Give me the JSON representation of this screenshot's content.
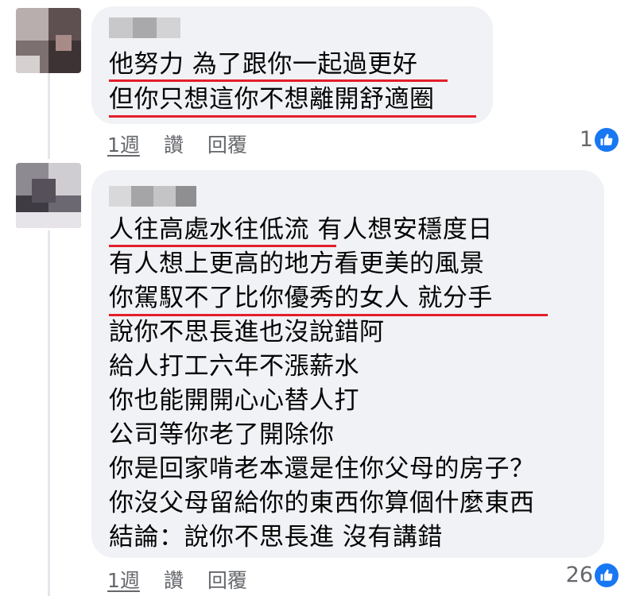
{
  "comments": [
    {
      "text_lines": [
        "他努力 為了跟你一起過更好",
        "但你只想這你不想離開舒適圈"
      ],
      "actions": {
        "time": "1週",
        "like": "讚",
        "reply": "回覆"
      },
      "reaction_count": "1"
    },
    {
      "text_lines": [
        "人往高處水往低流 有人想安穩度日",
        "有人想上更高的地方看更美的風景",
        "你駕馭不了比你優秀的女人 就分手",
        "說你不思長進也沒說錯阿",
        "給人打工六年不漲薪水",
        "你也能開開心心替人打",
        "公司等你老了開除你",
        "你是回家啃老本還是住你父母的房子？",
        "你沒父母留給你的東西你算個什麼東西",
        "結論：說你不思長進 沒有講錯"
      ],
      "actions": {
        "time": "1週",
        "like": "讚",
        "reply": "回覆"
      },
      "reaction_count": "26"
    }
  ],
  "colors": {
    "bubble": "#f0f2f5",
    "underline": "#e41e2b",
    "meta_text": "#65676b",
    "like_blue": "#1877f2"
  },
  "icons": {
    "reaction": "thumbs-up-like-icon"
  }
}
